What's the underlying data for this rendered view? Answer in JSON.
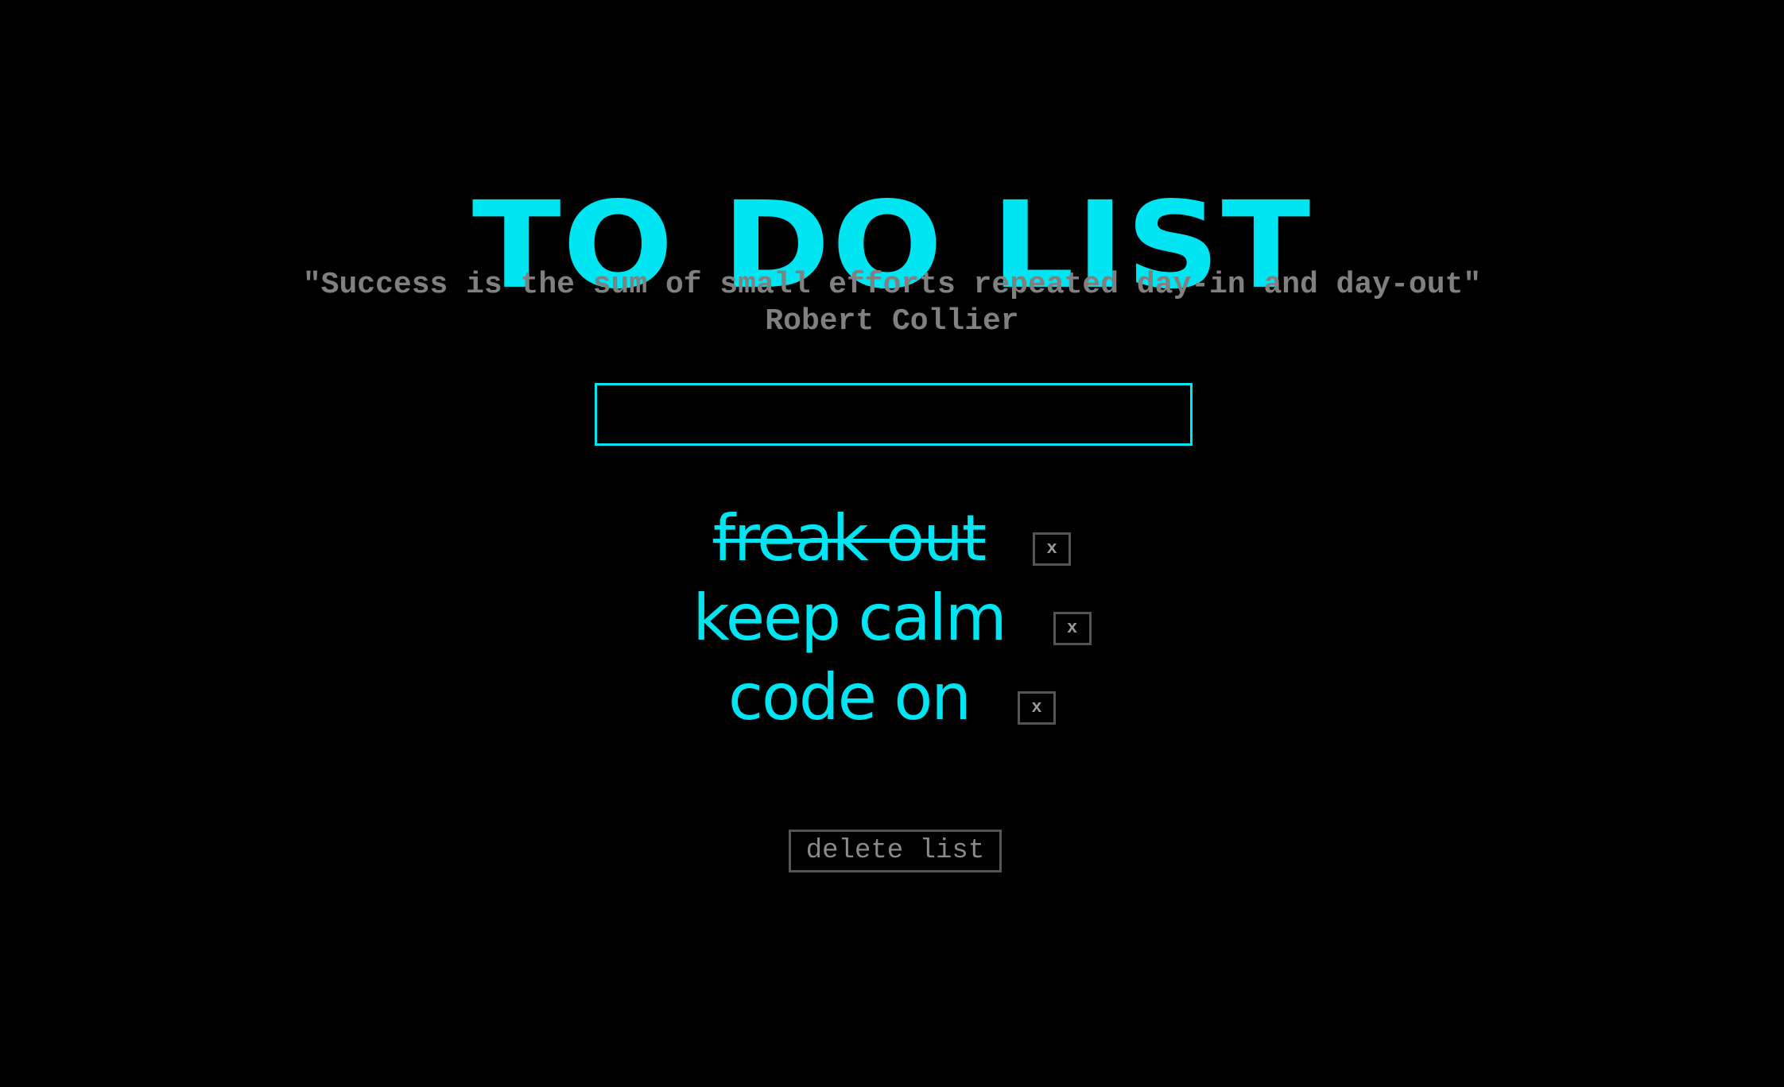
{
  "header": {
    "title": "TO DO LIST"
  },
  "quote": {
    "text": "\"Success is the sum of small efforts repeated day-in and day-out\"",
    "author": "Robert Collier"
  },
  "input": {
    "value": "",
    "placeholder": ""
  },
  "tasks": [
    {
      "text": "freak out",
      "completed": true,
      "remove_label": "x"
    },
    {
      "text": "keep calm",
      "completed": false,
      "remove_label": "x"
    },
    {
      "text": "code on",
      "completed": false,
      "remove_label": "x"
    }
  ],
  "actions": {
    "delete_list_label": "delete list"
  },
  "colors": {
    "background": "#000000",
    "accent": "#00e5f2",
    "muted_text": "#808080",
    "button_border": "#555555"
  }
}
